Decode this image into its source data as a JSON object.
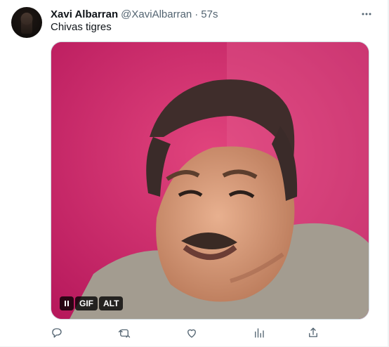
{
  "tweet": {
    "display_name": "Xavi Albarran",
    "handle": "@XaviAlbarran",
    "separator": "·",
    "time": "57s",
    "text": "Chivas tigres"
  },
  "media": {
    "type": "gif",
    "controls": {
      "gif_label": "GIF",
      "alt_label": "ALT"
    }
  },
  "icons": {
    "more": "more-horizontal-icon",
    "pause": "pause-icon",
    "reply": "reply-icon",
    "repost": "repost-icon",
    "like": "like-icon",
    "views": "views-icon",
    "share": "share-icon"
  },
  "colors": {
    "text_primary": "#0f1419",
    "text_secondary": "#536471",
    "media_background": "#c92a6d"
  }
}
